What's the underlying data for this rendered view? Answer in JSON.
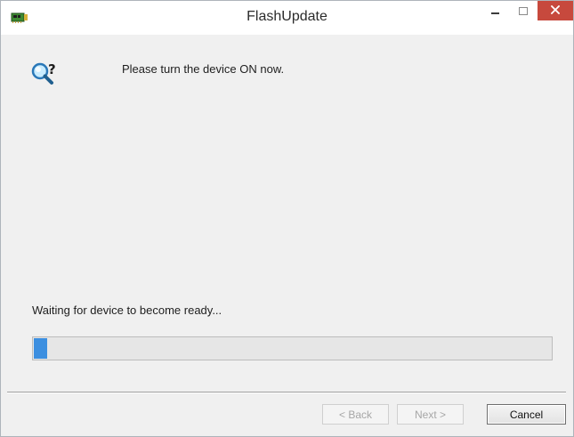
{
  "window": {
    "title": "FlashUpdate",
    "app_icon": "circuit-board-icon",
    "controls": {
      "minimize": "minimize-icon",
      "maximize": "maximize-icon",
      "close": "close-icon"
    }
  },
  "content": {
    "icon": "magnifier-question-icon",
    "message": "Please turn the device ON now.",
    "status": "Waiting for device to become ready...",
    "progress_fraction": 0.025
  },
  "buttons": {
    "back": "< Back",
    "next": "Next >",
    "cancel": "Cancel"
  },
  "colors": {
    "close_button": "#c7493d",
    "progress_fill": "#3c8fe0"
  }
}
